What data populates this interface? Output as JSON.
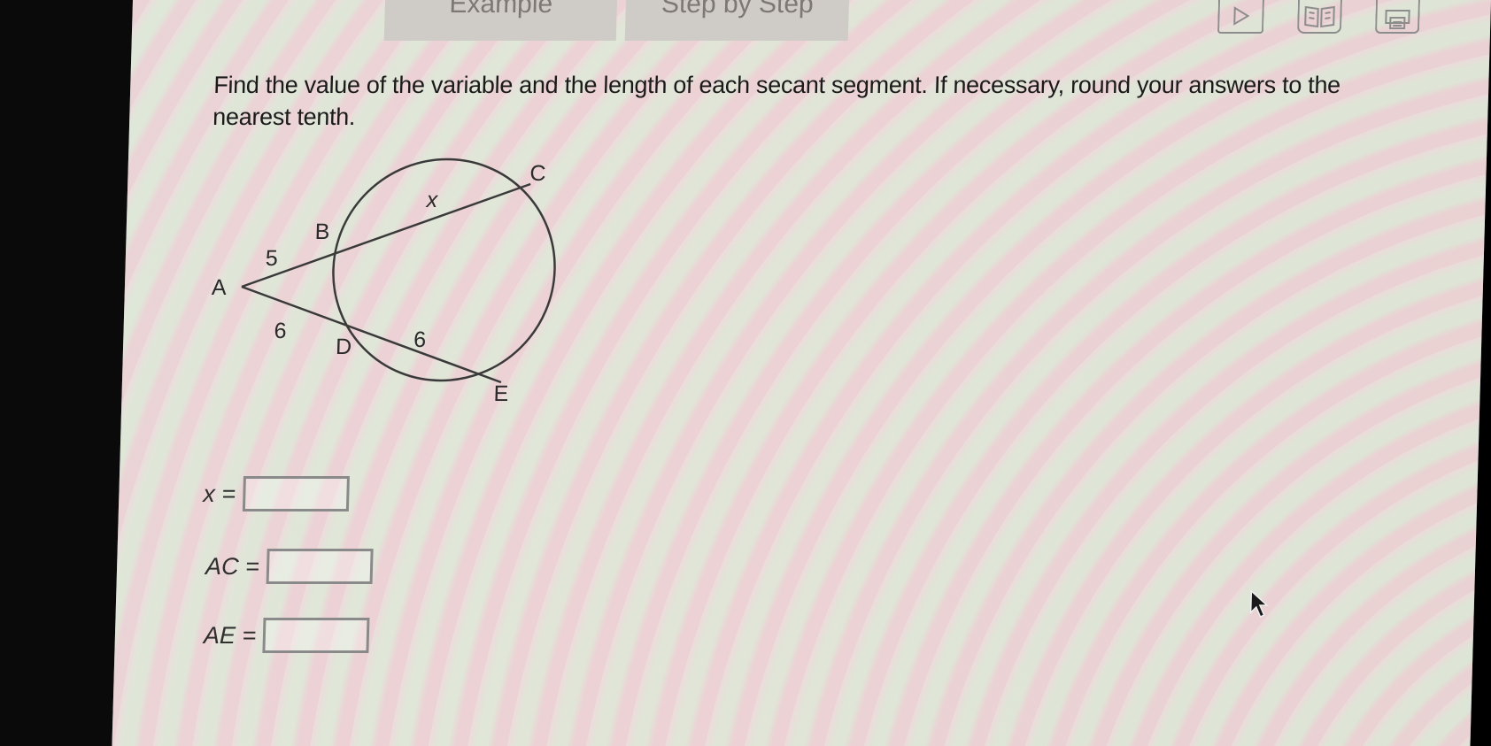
{
  "tabs": [
    {
      "label": "Example"
    },
    {
      "label": "Step by Step"
    }
  ],
  "toolbar": {
    "video_icon": "play-icon",
    "book_icon": "book-icon",
    "print_icon": "print-icon"
  },
  "question": {
    "prompt": "Find the value of the variable and the length of each secant segment. If necessary, round your answers to the nearest tenth."
  },
  "figure": {
    "points": [
      "A",
      "B",
      "C",
      "D",
      "E"
    ],
    "segment_labels": {
      "AB": "5",
      "BC": "x",
      "AD": "6",
      "DE": "6"
    }
  },
  "answers": [
    {
      "label": "x =",
      "value": ""
    },
    {
      "label": "AC =",
      "value": ""
    },
    {
      "label": "AE =",
      "value": ""
    }
  ],
  "colors": {
    "text": "#1a1a1a",
    "figure_stroke": "#3a3a3a",
    "input_border": "#8a8a8a"
  }
}
